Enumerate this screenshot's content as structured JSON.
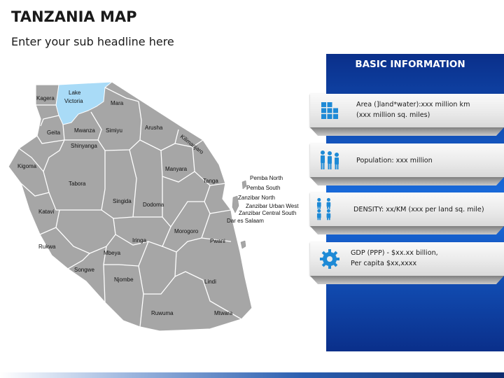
{
  "title": "TANZANIA MAP",
  "subtitle": "Enter your sub headline here",
  "map": {
    "regions": [
      "Kagera",
      "Mara",
      "Geita",
      "Mwanza",
      "Simiyu",
      "Shinyanga",
      "Arusha",
      "Kilimanjaro",
      "Kigoma",
      "Tabora",
      "Manyara",
      "Tanga",
      "Singida",
      "Dodoma",
      "Katavi",
      "Morogoro",
      "Pwani",
      "Rukwa",
      "Iringa",
      "Mbeya",
      "Songwe",
      "Njombe",
      "Lindi",
      "Ruwuma",
      "Mtwara"
    ],
    "lake_label": [
      "Lake",
      "Victoria"
    ],
    "zanzibar_labels": [
      "Pemba North",
      "Pemba South",
      "Zanzibar North",
      "Zanzibar Urban West",
      "Zanzibar Central South",
      "Dar es Salaam"
    ],
    "land_color": "#a6a6a6",
    "water_color": "#a9dbf7"
  },
  "info": {
    "header": "BASIC INFORMATION",
    "area_line1": "Area (]land*water):xxx million km",
    "area_line2": "(xxx million sq. miles)",
    "population": "Population: xxx million",
    "density": "DENSITY: xx/KM (xxx per land sq. mile)",
    "gdp_line1": "GDP (PPP) - $xx.xx billion,",
    "gdp_line2": "Per capita $xx,xxxx",
    "icons": [
      "grid-icon",
      "people-icon",
      "people-grid-icon",
      "gear-icon"
    ],
    "accent_color": "#1a6ee0",
    "icon_color": "#1e8ad6"
  }
}
